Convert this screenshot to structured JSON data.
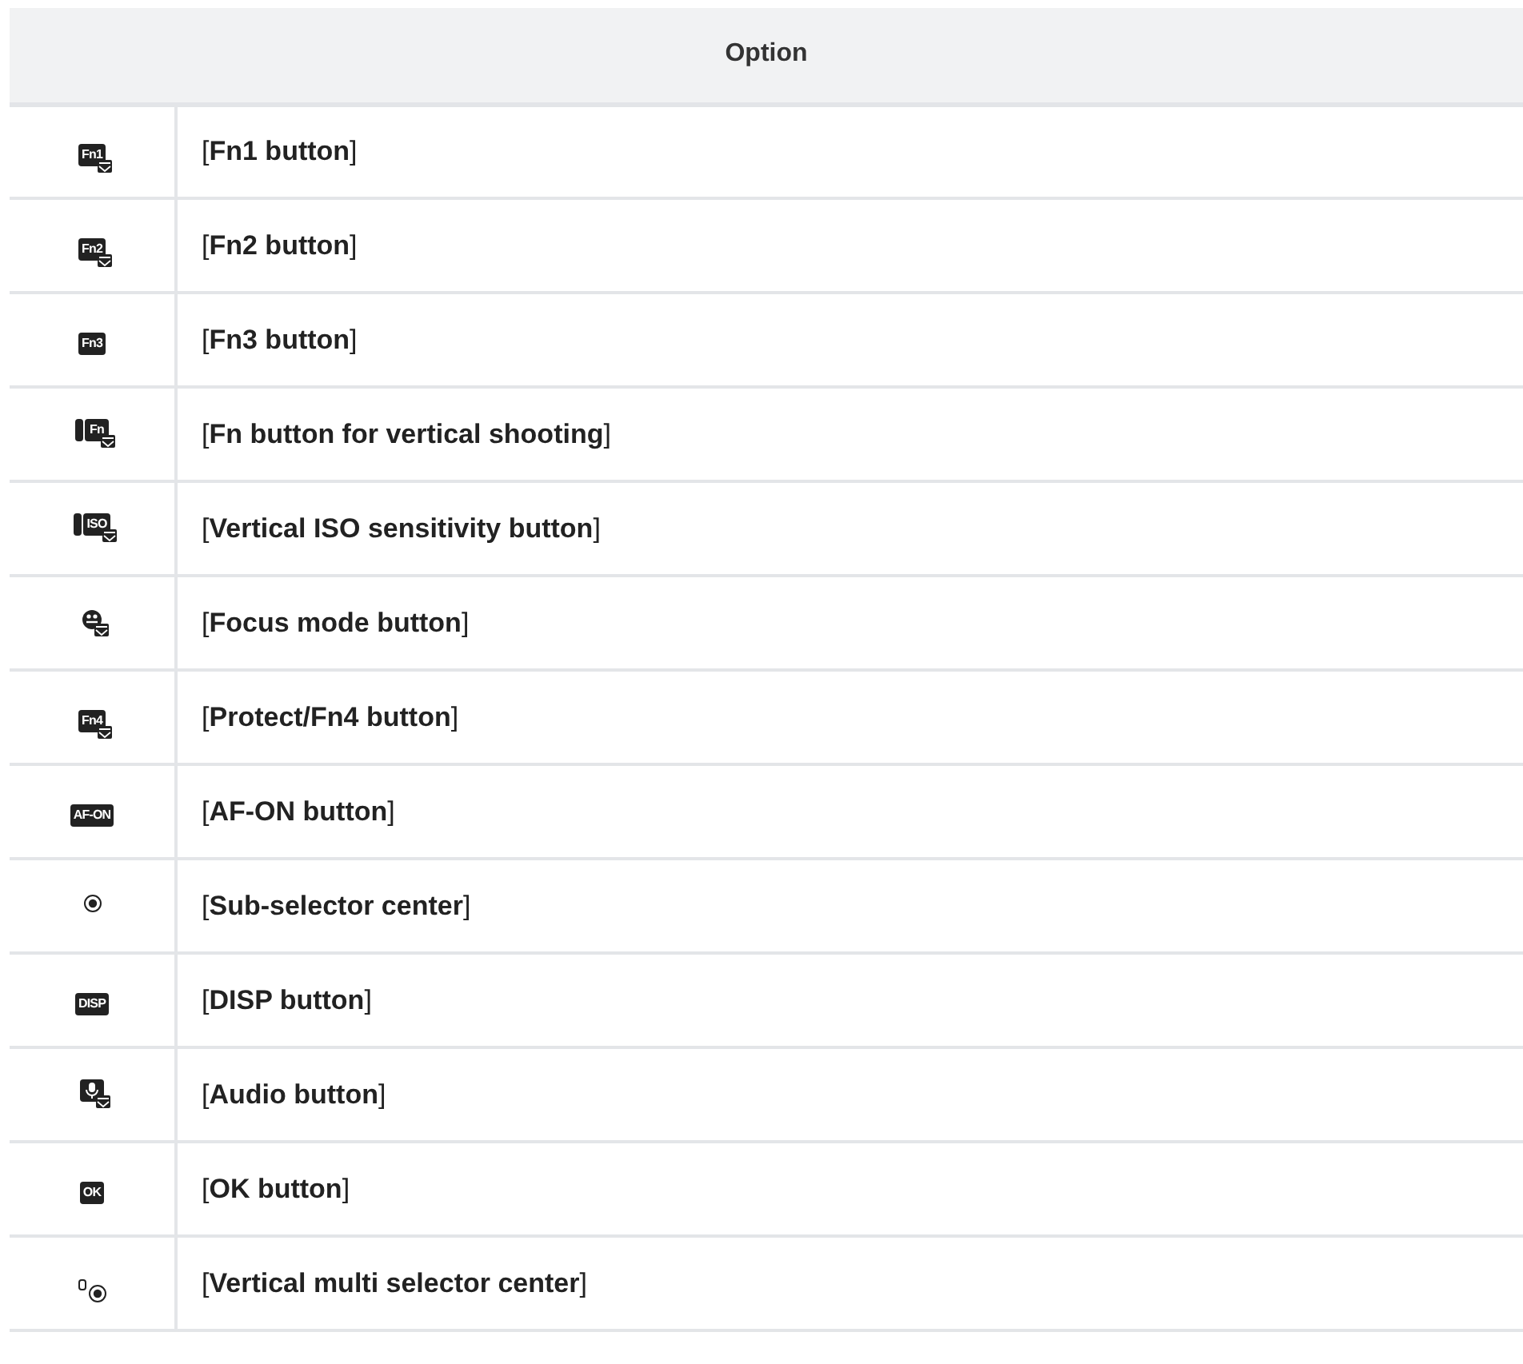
{
  "table": {
    "columns": [
      "Option"
    ],
    "rows": [
      {
        "icon": {
          "kind": "badge-menu",
          "text": "Fn1"
        },
        "option": "[**Fn1 button**]"
      },
      {
        "icon": {
          "kind": "badge-menu",
          "text": "Fn2"
        },
        "option": "[**Fn2 button**]"
      },
      {
        "icon": {
          "kind": "badge",
          "text": "Fn3"
        },
        "option": "[**Fn3 button**]"
      },
      {
        "icon": {
          "kind": "vertical-menu",
          "text": "Fn"
        },
        "option": "[**Fn button for vertical shooting**]"
      },
      {
        "icon": {
          "kind": "vertical-menu",
          "text": "ISO"
        },
        "option": "[**Vertical ISO sensitivity button**]"
      },
      {
        "icon": {
          "kind": "focus-menu"
        },
        "option": "[**Focus mode button**]"
      },
      {
        "icon": {
          "kind": "badge-menu",
          "text": "Fn4"
        },
        "option": "[**Protect/Fn4 button**]"
      },
      {
        "icon": {
          "kind": "badge",
          "text": "AF-ON"
        },
        "option": "[**AF-ON button**]"
      },
      {
        "icon": {
          "kind": "selector"
        },
        "option": "[**Sub-selector center**]"
      },
      {
        "icon": {
          "kind": "badge",
          "text": "DISP"
        },
        "option": "[**DISP button**]"
      },
      {
        "icon": {
          "kind": "mic-menu"
        },
        "option": "[**Audio button**]"
      },
      {
        "icon": {
          "kind": "badge",
          "text": "OK"
        },
        "option": "[**OK button**]"
      },
      {
        "icon": {
          "kind": "vertical-selector"
        },
        "option": "[**Vertical multi selector center**]"
      }
    ]
  }
}
